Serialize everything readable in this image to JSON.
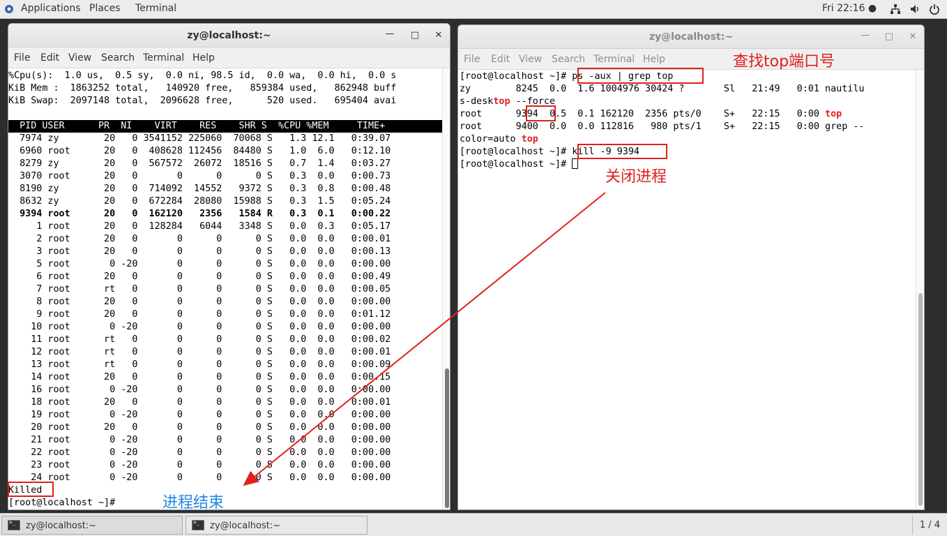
{
  "topbar": {
    "applications": "Applications",
    "places": "Places",
    "terminal": "Terminal",
    "clock": "Fri 22:16 ●"
  },
  "left_window": {
    "title": "zy@localhost:~",
    "menu": [
      "File",
      "Edit",
      "View",
      "Search",
      "Terminal",
      "Help"
    ],
    "summary": [
      "%Cpu(s):  1.0 us,  0.5 sy,  0.0 ni, 98.5 id,  0.0 wa,  0.0 hi,  0.0 s",
      "KiB Mem :  1863252 total,   140920 free,   859384 used,   862948 buff",
      "KiB Swap:  2097148 total,  2096628 free,      520 used.   695404 avai"
    ],
    "header": "  PID USER      PR  NI    VIRT    RES    SHR S  %CPU %MEM     TIME+ ",
    "rows": [
      "  7974 zy        20   0 3541152 225060  70068 S   1.3 12.1   0:39.07",
      "  6960 root      20   0  408628 112456  84480 S   1.0  6.0   0:12.10",
      "  8279 zy        20   0  567572  26072  18516 S   0.7  1.4   0:03.27",
      "  3070 root      20   0       0      0      0 S   0.3  0.0   0:00.73",
      "  8190 zy        20   0  714092  14552   9372 S   0.3  0.8   0:00.48",
      "  8632 zy        20   0  672284  28080  15988 S   0.3  1.5   0:05.24",
      "  9394 root      20   0  162120   2356   1584 R   0.3  0.1   0:00.22",
      "     1 root      20   0  128284   6044   3348 S   0.0  0.3   0:05.17",
      "     2 root      20   0       0      0      0 S   0.0  0.0   0:00.01",
      "     3 root      20   0       0      0      0 S   0.0  0.0   0:00.13",
      "     5 root       0 -20       0      0      0 S   0.0  0.0   0:00.00",
      "     6 root      20   0       0      0      0 S   0.0  0.0   0:00.49",
      "     7 root      rt   0       0      0      0 S   0.0  0.0   0:00.05",
      "     8 root      20   0       0      0      0 S   0.0  0.0   0:00.00",
      "     9 root      20   0       0      0      0 S   0.0  0.0   0:01.12",
      "    10 root       0 -20       0      0      0 S   0.0  0.0   0:00.00",
      "    11 root      rt   0       0      0      0 S   0.0  0.0   0:00.02",
      "    12 root      rt   0       0      0      0 S   0.0  0.0   0:00.01",
      "    13 root      rt   0       0      0      0 S   0.0  0.0   0:00.09",
      "    14 root      20   0       0      0      0 S   0.0  0.0   0:00.15",
      "    16 root       0 -20       0      0      0 S   0.0  0.0   0:00.00",
      "    18 root      20   0       0      0      0 S   0.0  0.0   0:00.01",
      "    19 root       0 -20       0      0      0 S   0.0  0.0   0:00.00",
      "    20 root      20   0       0      0      0 S   0.0  0.0   0:00.00",
      "    21 root       0 -20       0      0      0 S   0.0  0.0   0:00.00",
      "    22 root       0 -20       0      0      0 S   0.0  0.0   0:00.00",
      "    23 root       0 -20       0      0      0 S   0.0  0.0   0:00.00",
      "    24 root       0 -20       0      0      0 S   0.0  0.0   0:00.00"
    ],
    "killed": "Killed",
    "prompt": "[root@localhost ~]#"
  },
  "right_window": {
    "title": "zy@localhost:~",
    "menu": [
      "File",
      "Edit",
      "View",
      "Search",
      "Terminal",
      "Help"
    ],
    "line1_prompt": "[root@localhost ~]# ",
    "line1_cmd": "ps -aux | grep top",
    "line2": "zy        8245  0.0  1.6 1004976 30424 ?       Sl   21:49   0:01 nautilu",
    "line3_a": "s-desk",
    "line3_b": "top",
    "line3_c": " --force",
    "line4_a": "root      ",
    "line4_pid": "9394",
    "line4_b": "  0.5  0.1 162120  2356 pts/0    S+   22:15   0:00 ",
    "line4_c": "top",
    "line5": "root      9400  0.0  0.0 112816   980 pts/1    S+   22:15   0:00 grep --",
    "line6_a": "color=auto ",
    "line6_b": "top",
    "line7_prompt": "[root@localhost ~]# ",
    "line7_cmd": "kill -9 9394",
    "line8_prompt": "[root@localhost ~]# "
  },
  "annotations": {
    "find_port": "查找top端口号",
    "close_process": "关闭进程",
    "process_end": "进程结束"
  },
  "taskbar": {
    "task1": "zy@localhost:~",
    "task2": "zy@localhost:~",
    "pager": "1 / 4"
  },
  "colors": {
    "annotation_red": "#e0201c",
    "annotation_blue": "#1e88e5",
    "terminal_highlight": "#e02020"
  }
}
